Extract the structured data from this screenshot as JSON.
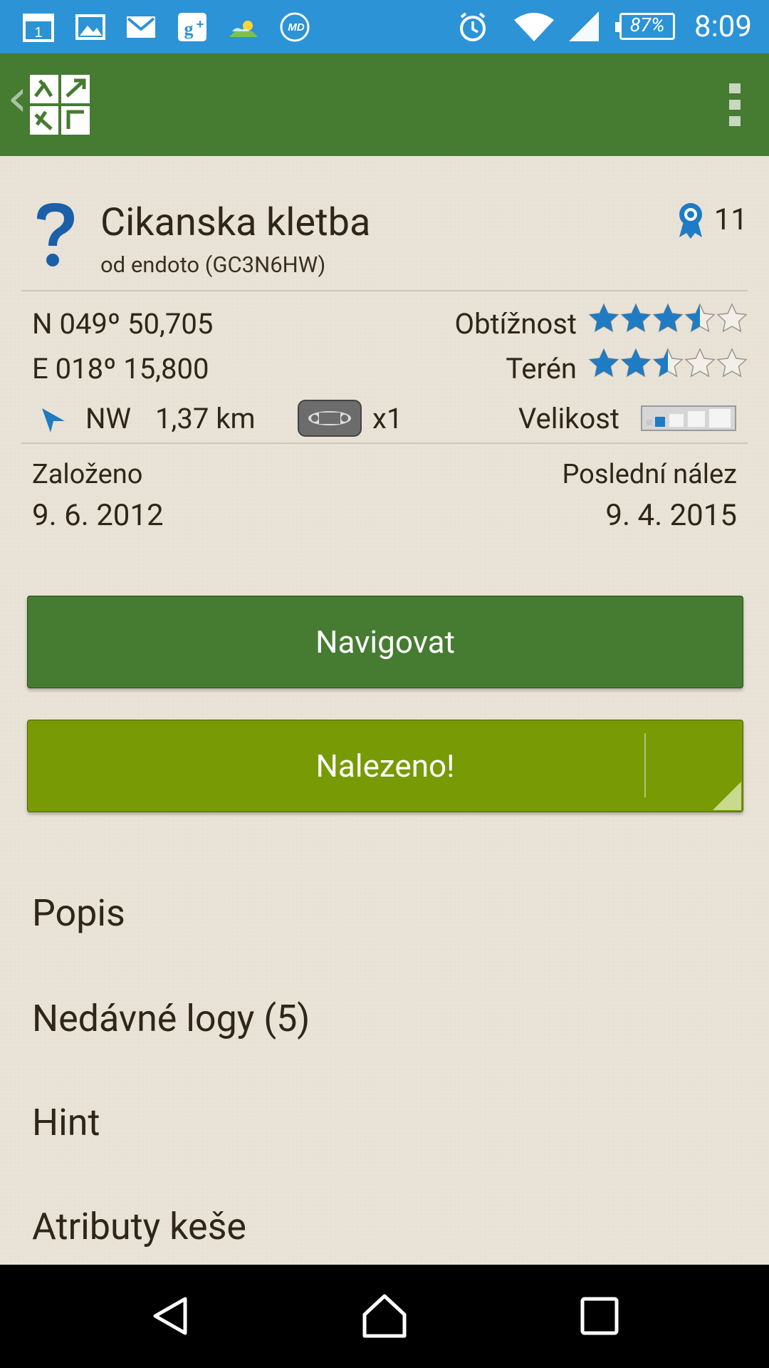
{
  "status_bar": {
    "time": "8:09",
    "battery": "87%",
    "icons": [
      "calendar-icon",
      "gallery-icon",
      "gmail-icon",
      "google-plus-icon",
      "weather-icon",
      "moto-app-icon",
      "alarm-icon",
      "wifi-icon",
      "signal-icon",
      "battery-icon"
    ]
  },
  "app_bar": {
    "back_glyph": "‹",
    "logo": "geocaching-logo",
    "menu": "overflow-menu-icon"
  },
  "cache": {
    "title": "Cikanska kletba",
    "owner_line": "od endoto (GC3N6HW)",
    "favorites": "11",
    "type_icon": "mystery-cache-icon"
  },
  "details": {
    "lat": "N  049º  50,705",
    "lon": "E  018º  15,800",
    "difficulty_label": "Obtížnost",
    "difficulty": 3.5,
    "terrain_label": "Terén",
    "terrain": 2.5,
    "direction": "NW",
    "distance": "1,37 km",
    "trackables": "x1",
    "size_label": "Velikost",
    "size_level": 1
  },
  "dates": {
    "placed_label": "Založeno",
    "placed_date": "9. 6. 2012",
    "last_found_label": "Poslední nález",
    "last_found_date": "9. 4. 2015"
  },
  "buttons": {
    "navigate": "Navigovat",
    "found": "Nalezeno!"
  },
  "sections": [
    "Popis",
    "Nedávné logy (5)",
    "Hint",
    "Atributy keše"
  ],
  "colors": {
    "status_bar": "#2b93d6",
    "app_bar": "#467b32",
    "navigate_button": "#467b32",
    "found_button": "#779a05",
    "star": "#1e7bc4"
  }
}
